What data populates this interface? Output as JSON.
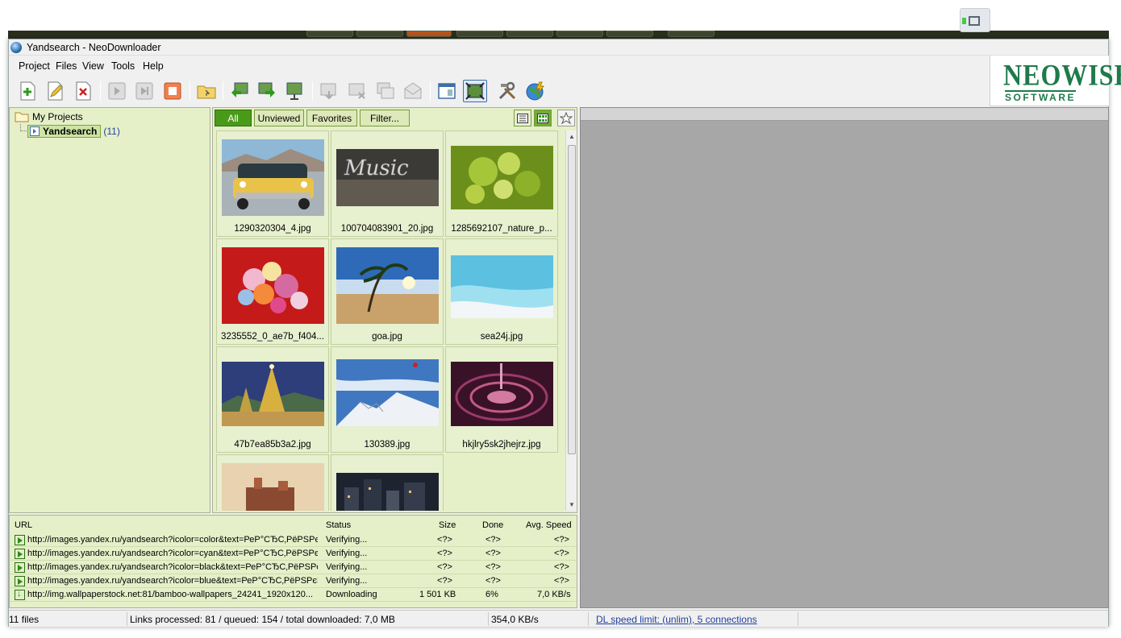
{
  "window": {
    "title": "Yandsearch - NeoDownloader"
  },
  "menu": [
    "Project",
    "Files",
    "View",
    "Tools",
    "Help"
  ],
  "logo": {
    "line1": "NEOWISE",
    "line2": "SOFTWARE"
  },
  "toolbar": {
    "icons": [
      "add-project-icon",
      "edit-project-icon",
      "delete-project-icon",
      "start-icon",
      "resume-icon",
      "stop-icon",
      "open-folder-icon",
      "import-icon",
      "export-icon",
      "slideshow-icon",
      "download-file-icon",
      "delete-file-icon",
      "copy-file-icon",
      "email-file-icon",
      "preview-window-icon",
      "fit-image-icon",
      "settings-icon",
      "web-update-icon"
    ]
  },
  "tree": {
    "root": "My Projects",
    "project": {
      "name": "Yandsearch",
      "count": "(11)"
    }
  },
  "filters": {
    "all": "All",
    "unviewed": "Unviewed",
    "favorites": "Favorites",
    "filter": "Filter..."
  },
  "thumbnails": [
    {
      "caption": "1290320304_4.jpg",
      "kind": "car"
    },
    {
      "caption": "100704083901_20.jpg",
      "kind": "music"
    },
    {
      "caption": "1285692107_nature_p...",
      "kind": "leaves"
    },
    {
      "caption": "3235552_0_ae7b_f404...",
      "kind": "flowers"
    },
    {
      "caption": "goa.jpg",
      "kind": "beach"
    },
    {
      "caption": "sea24j.jpg",
      "kind": "sea"
    },
    {
      "caption": "47b7ea85b3a2.jpg",
      "kind": "tree"
    },
    {
      "caption": "130389.jpg",
      "kind": "ski"
    },
    {
      "caption": "hkjlry5sk2jhejrz.jpg",
      "kind": "drop"
    },
    {
      "caption": "",
      "kind": "ship"
    },
    {
      "caption": "",
      "kind": "city"
    }
  ],
  "downloads": {
    "columns": {
      "url": "URL",
      "status": "Status",
      "size": "Size",
      "done": "Done",
      "speed": "Avg. Speed"
    },
    "rows": [
      {
        "icon": "play",
        "url": "http://images.yandex.ru/yandsearch?icolor=color&text=РеР°СЂС‚РёРЅРєРё...",
        "status": "Verifying...",
        "size": "<?>",
        "done": "<?>",
        "speed": "<?>"
      },
      {
        "icon": "play",
        "url": "http://images.yandex.ru/yandsearch?icolor=cyan&text=РеР°СЂС‚РёРЅРєРё...",
        "status": "Verifying...",
        "size": "<?>",
        "done": "<?>",
        "speed": "<?>"
      },
      {
        "icon": "play",
        "url": "http://images.yandex.ru/yandsearch?icolor=black&text=РеР°СЂС‚РёРЅРєРё...",
        "status": "Verifying...",
        "size": "<?>",
        "done": "<?>",
        "speed": "<?>"
      },
      {
        "icon": "play",
        "url": "http://images.yandex.ru/yandsearch?icolor=blue&text=РеР°СЂС‚РёРЅРєРё...",
        "status": "Verifying...",
        "size": "<?>",
        "done": "<?>",
        "speed": "<?>"
      },
      {
        "icon": "down",
        "url": "http://img.wallpaperstock.net:81/bamboo-wallpapers_24241_1920x120...",
        "status": "Downloading",
        "size": "1 501 KB",
        "done": "6%",
        "speed": "7,0 KB/s"
      }
    ]
  },
  "status": {
    "files": "11 files",
    "links": "Links processed: 81 / queued: 154 / total downloaded: 7,0 MB",
    "speed": "354,0 KB/s",
    "limit": "DL speed limit: (unlim), 5 connections"
  },
  "colors": {
    "pane_bg": "#e5efc8",
    "accent_green": "#4a9a1a",
    "preview_bg": "#a7a7a7",
    "link": "#1f3fa0"
  }
}
